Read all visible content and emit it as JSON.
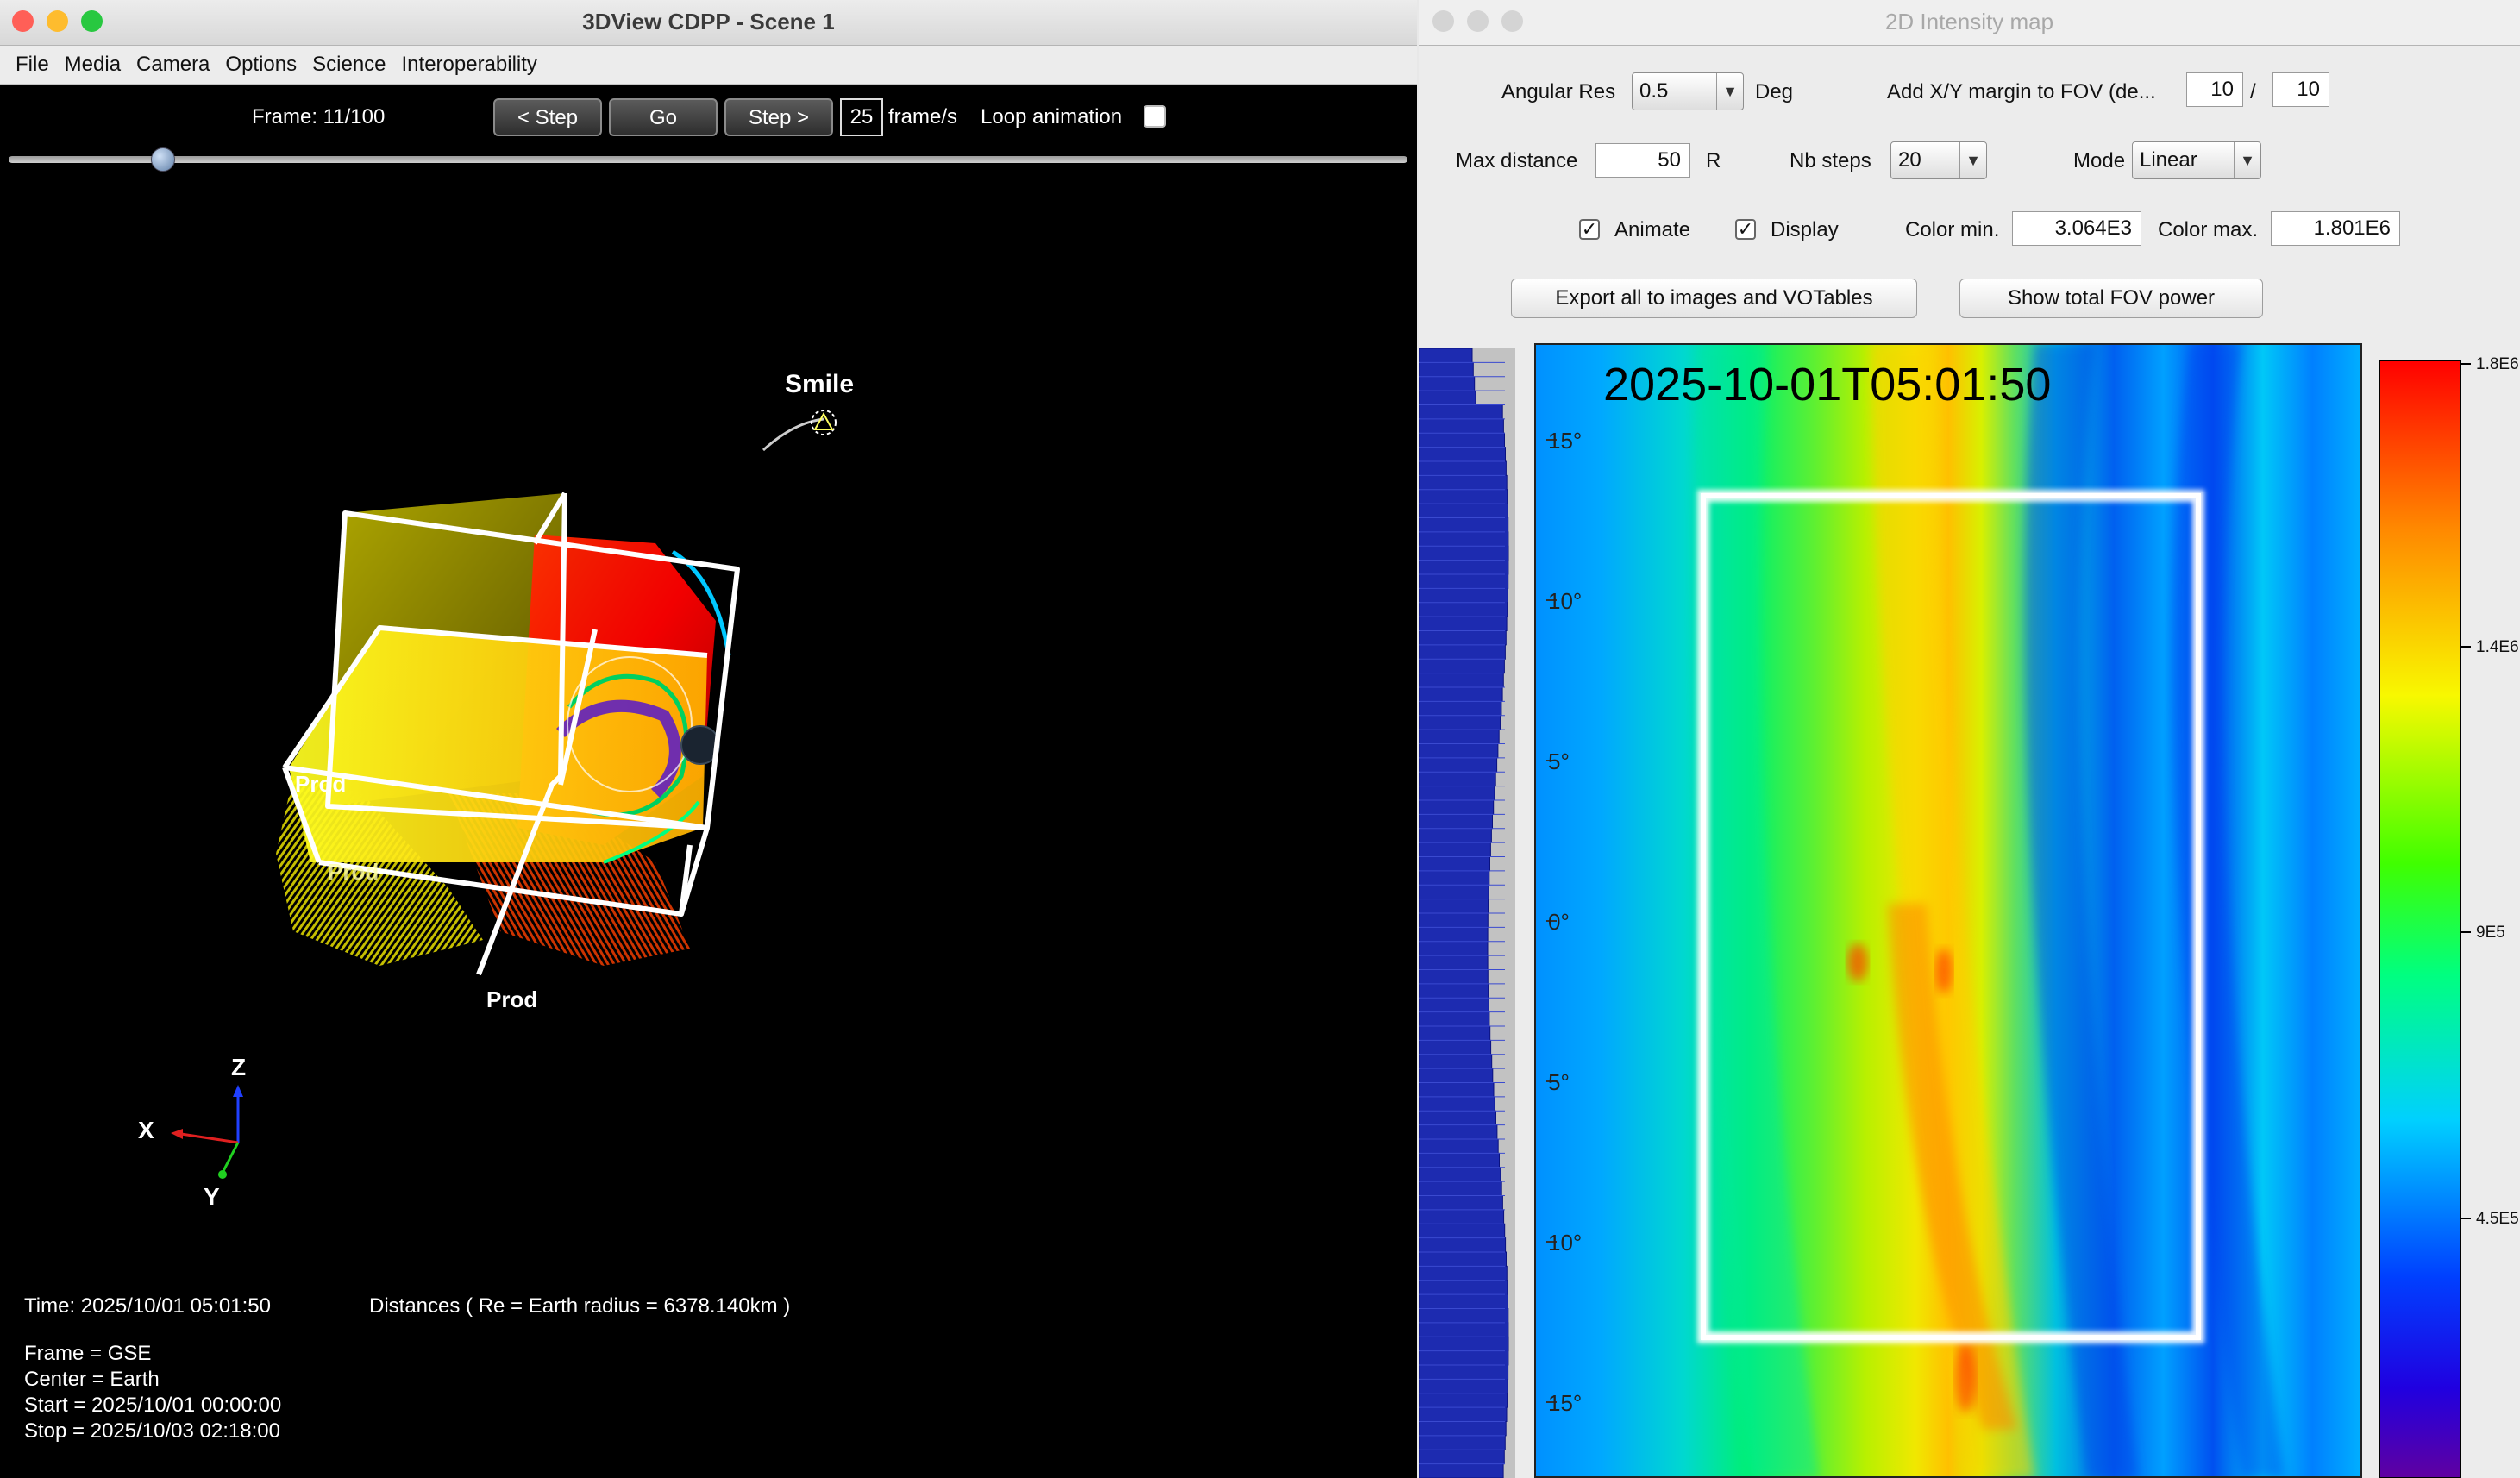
{
  "window3d": {
    "title": "3DView CDPP - Scene 1",
    "menu": [
      "File",
      "Media",
      "Camera",
      "Options",
      "Science",
      "Interoperability"
    ],
    "frame_label": "Frame: 11/100",
    "frame_current": 11,
    "frame_total": 100,
    "step_back_label": "< Step",
    "go_label": "Go",
    "step_forward_label": "Step >",
    "fps_value": "25",
    "fps_unit": "frame/s",
    "loop_label": "Loop animation",
    "loop_checked": false,
    "slider_fraction": 0.11,
    "scene": {
      "spacecraft_label": "Smile",
      "prod_labels": [
        "Prod",
        "Prod",
        "Prod"
      ],
      "axes": {
        "x": "X",
        "y": "Y",
        "z": "Z"
      }
    },
    "info": {
      "time": "Time: 2025/10/01 05:01:50",
      "distances": "Distances ( Re = Earth radius = 6378.140km )",
      "frame": "Frame = GSE",
      "center": "Center = Earth",
      "start": "Start = 2025/10/01 00:00:00",
      "stop": "Stop = 2025/10/03 02:18:00"
    }
  },
  "window2d": {
    "title": "2D Intensity map",
    "angular_res_label": "Angular Res",
    "angular_res_value": "0.5",
    "deg_label": "Deg",
    "margin_label": "Add X/Y margin to FOV (de...",
    "margin_x": "10",
    "margin_sep": "/",
    "margin_y": "10",
    "max_distance_label": "Max distance",
    "max_distance_value": "50",
    "max_distance_unit": "R",
    "nb_steps_label": "Nb steps",
    "nb_steps_value": "20",
    "mode_label": "Mode",
    "mode_value": "Linear",
    "animate_label": "Animate",
    "animate_checked": true,
    "display_label": "Display",
    "display_checked": true,
    "color_min_label": "Color min.",
    "color_min_value": "3.064E3",
    "color_max_label": "Color max.",
    "color_max_value": "1.801E6",
    "export_button": "Export all to images and VOTables",
    "fov_power_button": "Show total FOV power",
    "map": {
      "timestamp": "2025-10-01T05:01:50",
      "y_ticks": [
        "15°",
        "10°",
        "5°",
        "0°",
        "5°",
        "10°",
        "15°"
      ],
      "colorbar_ticks": [
        "1.8E6",
        "1.4E6",
        "9E5",
        "4.5E5"
      ]
    },
    "colors": {
      "accent_red": "#ff2200",
      "low_blue": "#0010c8"
    }
  }
}
